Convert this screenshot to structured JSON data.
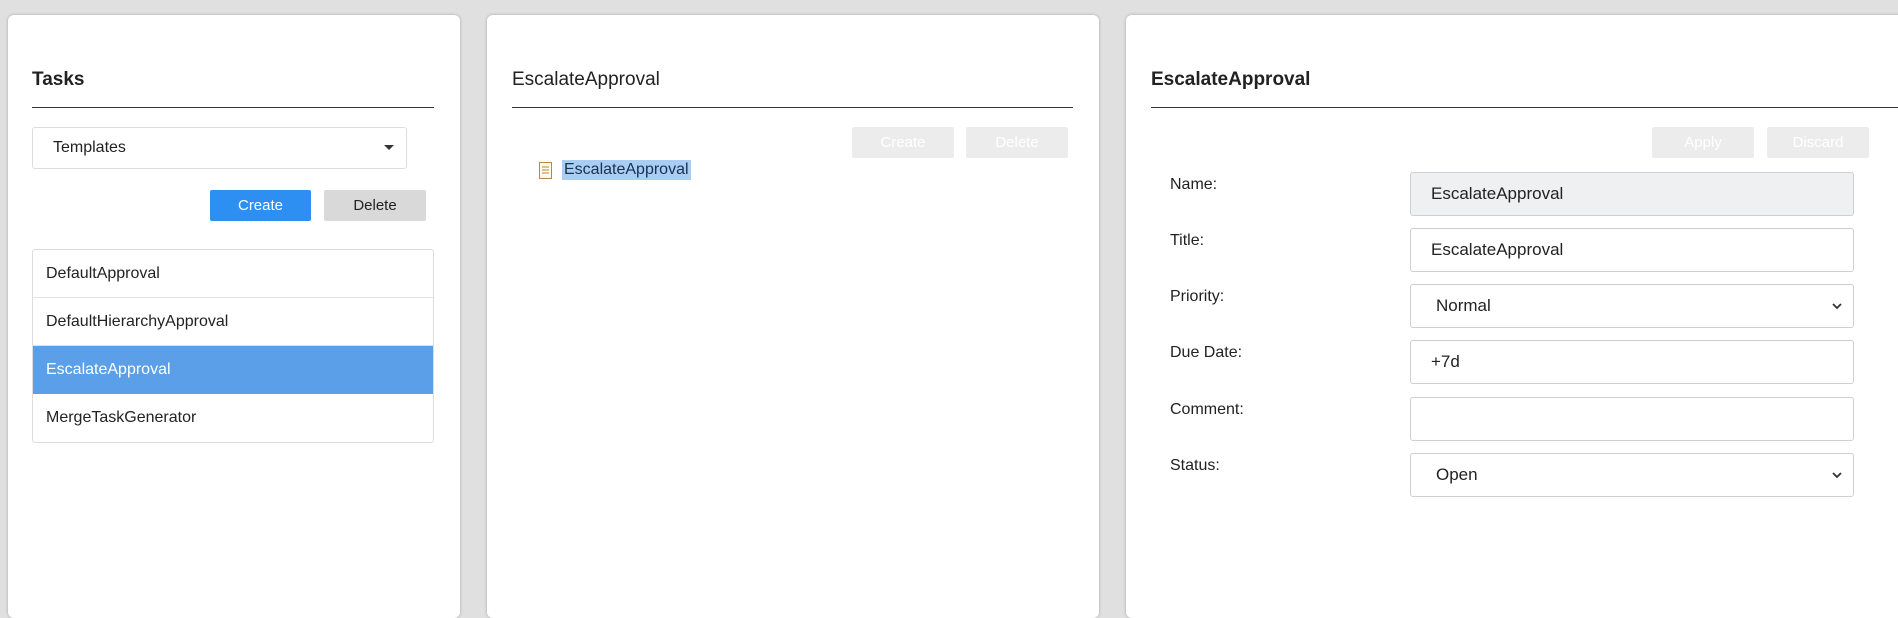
{
  "tasks_panel": {
    "title": "Tasks",
    "filter_value": "Templates",
    "create_label": "Create",
    "delete_label": "Delete",
    "items": [
      {
        "label": "DefaultApproval"
      },
      {
        "label": "DefaultHierarchyApproval"
      },
      {
        "label": "EscalateApproval"
      },
      {
        "label": "MergeTaskGenerator"
      }
    ],
    "selected_index": 2
  },
  "tree_panel": {
    "title": "EscalateApproval",
    "create_label": "Create",
    "delete_label": "Delete",
    "node_label": "EscalateApproval",
    "node_icon": "document-icon"
  },
  "detail_panel": {
    "title": "EscalateApproval",
    "apply_label": "Apply",
    "discard_label": "Discard",
    "fields": {
      "name": {
        "label": "Name:",
        "value": "EscalateApproval"
      },
      "title": {
        "label": "Title:",
        "value": "EscalateApproval"
      },
      "priority": {
        "label": "Priority:",
        "value": "Normal"
      },
      "due_date": {
        "label": "Due Date:",
        "value": "+7d"
      },
      "comment": {
        "label": "Comment:",
        "value": ""
      },
      "status": {
        "label": "Status:",
        "value": "Open"
      }
    }
  },
  "colors": {
    "primary": "#2e8ff2",
    "selection": "#5b9fe8",
    "node_highlight": "#a9cdf3"
  }
}
